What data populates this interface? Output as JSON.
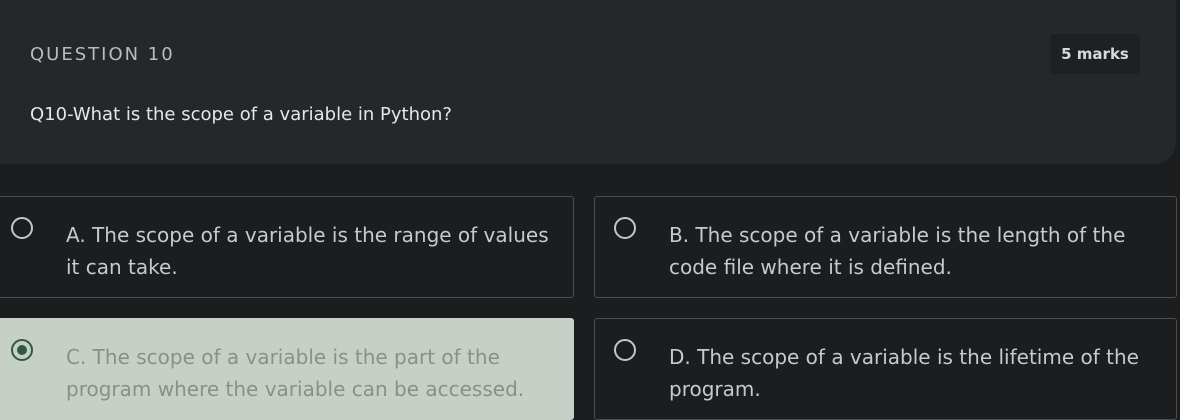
{
  "question": {
    "label": "QUESTION 10",
    "marks": "5 marks",
    "text": "Q10-What is the scope of a variable in Python?"
  },
  "options": [
    {
      "label": "A. The scope of a variable is the range of values\nit can take.",
      "selected": false
    },
    {
      "label": "B. The scope of a variable is the length of the\ncode file where it is defined.",
      "selected": false
    },
    {
      "label": "C. The scope of a variable is the part of the\nprogram where the variable can be accessed.",
      "selected": true
    },
    {
      "label": "D. The scope of a variable is the lifetime of the\nprogram.",
      "selected": false
    }
  ],
  "colors": {
    "background": "#1b1d1f",
    "card": "#25282b",
    "selected_fill": "#c7d0c7",
    "selected_radio": "#2f5a3e"
  }
}
